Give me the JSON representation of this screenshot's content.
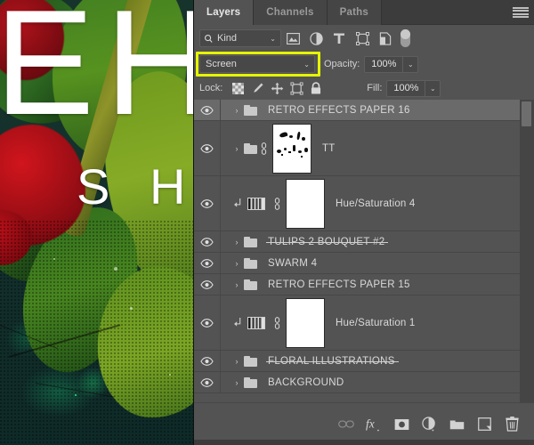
{
  "app": {
    "name": "Adobe Photoshop Layers Panel"
  },
  "canvas": {
    "letters": {
      "e": "E",
      "h": "H",
      "s": "S",
      "h2": "H"
    }
  },
  "panel": {
    "tabs": [
      {
        "label": "Layers",
        "active": true
      },
      {
        "label": "Channels",
        "active": false
      },
      {
        "label": "Paths",
        "active": false
      }
    ],
    "menu_icon": "hamburger-menu-icon",
    "filter": {
      "kind_label": "Kind",
      "search_icon": "search-icon",
      "chevron": "⌄",
      "icons": [
        "pixel-layer-filter-icon",
        "adjustment-layer-filter-icon",
        "type-layer-filter-icon",
        "shape-layer-filter-icon",
        "smart-object-filter-icon"
      ],
      "toggle": "filter-enable-toggle"
    },
    "blend": {
      "mode": "Screen",
      "mode_chevron": "⌄",
      "highlight_color": "#e6f500",
      "opacity_label": "Opacity:",
      "opacity_value": "100%",
      "opacity_chevron": "⌄"
    },
    "lock": {
      "label": "Lock:",
      "icons": [
        "lock-transparent-pixels-icon",
        "lock-image-pixels-icon",
        "lock-position-icon",
        "lock-artboard-nesting-icon",
        "lock-all-icon"
      ],
      "fill_label": "Fill:",
      "fill_value": "100%",
      "fill_chevron": "⌄"
    },
    "layers": [
      {
        "name": "RETRO EFFECTS PAPER 16",
        "type": "group",
        "selected": true,
        "visible": true,
        "height": "short",
        "struck": false
      },
      {
        "name": "TT",
        "type": "group",
        "selected": false,
        "visible": true,
        "height": "tall",
        "has_mask": true,
        "has_link": true,
        "struck": false
      },
      {
        "name": "Hue/Saturation 4",
        "type": "adjustment",
        "selected": false,
        "visible": true,
        "height": "tall",
        "clipped": true,
        "has_mask": true,
        "has_link": true,
        "struck": false
      },
      {
        "name": "TULIPS 2 BOUQUET #2",
        "type": "group",
        "selected": false,
        "visible": true,
        "height": "short",
        "struck": true
      },
      {
        "name": "SWARM 4",
        "type": "group",
        "selected": false,
        "visible": true,
        "height": "short",
        "struck": false
      },
      {
        "name": "RETRO EFFECTS PAPER 15",
        "type": "group",
        "selected": false,
        "visible": true,
        "height": "short",
        "struck": false
      },
      {
        "name": "Hue/Saturation 1",
        "type": "adjustment",
        "selected": false,
        "visible": true,
        "height": "tall",
        "clipped": true,
        "has_mask": true,
        "has_link": true,
        "struck": false
      },
      {
        "name": "FLORAL ILLUSTRATIONS",
        "type": "group",
        "selected": false,
        "visible": true,
        "height": "short",
        "struck": true
      },
      {
        "name": "BACKGROUND",
        "type": "group",
        "selected": false,
        "visible": true,
        "height": "short",
        "struck": false
      }
    ],
    "bottom_toolbar": [
      {
        "icon": "link-layers-icon",
        "dim": true
      },
      {
        "icon": "layer-style-fx-icon",
        "dim": false
      },
      {
        "icon": "add-layer-mask-icon",
        "dim": false
      },
      {
        "icon": "new-fill-adjustment-layer-icon",
        "dim": false
      },
      {
        "icon": "new-group-icon",
        "dim": false
      },
      {
        "icon": "new-layer-icon",
        "dim": false
      },
      {
        "icon": "delete-layer-icon",
        "dim": false
      }
    ]
  },
  "colors": {
    "panel_bg": "#535353",
    "row_selected": "#6a6a6a",
    "tab_bar": "#3c3c3c",
    "accent_highlight": "#e6f500",
    "text": "#d9d9d9"
  }
}
